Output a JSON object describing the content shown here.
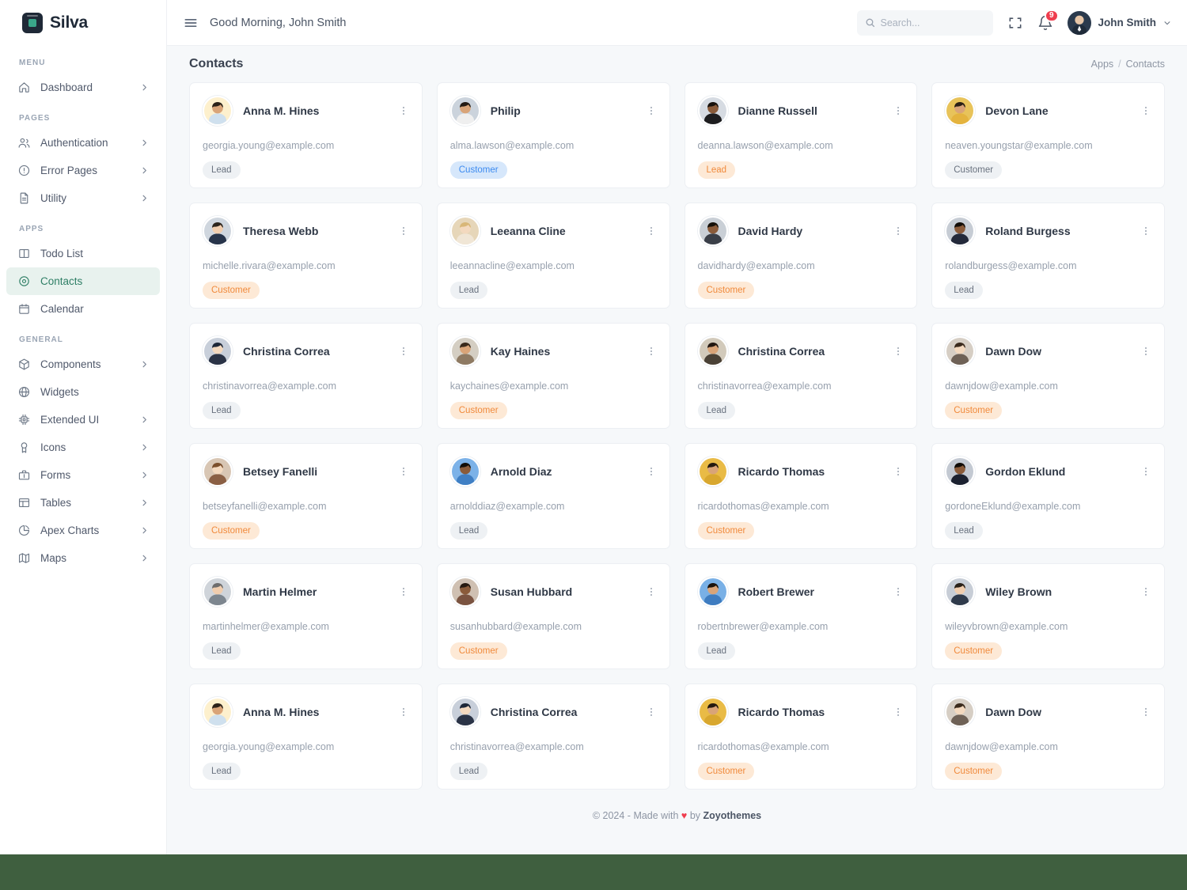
{
  "brand": {
    "name": "Silva",
    "logo_icon": "silva-logo-icon"
  },
  "sidebar": {
    "sections": [
      {
        "label": "MENU",
        "items": [
          {
            "label": "Dashboard",
            "icon": "home-icon",
            "chevron": true,
            "active": false
          }
        ]
      },
      {
        "label": "PAGES",
        "items": [
          {
            "label": "Authentication",
            "icon": "users-icon",
            "chevron": true,
            "active": false
          },
          {
            "label": "Error Pages",
            "icon": "alert-circle-icon",
            "chevron": true,
            "active": false
          },
          {
            "label": "Utility",
            "icon": "file-text-icon",
            "chevron": true,
            "active": false
          }
        ]
      },
      {
        "label": "APPS",
        "items": [
          {
            "label": "Todo List",
            "icon": "columns-icon",
            "chevron": false,
            "active": false
          },
          {
            "label": "Contacts",
            "icon": "map-pin-icon",
            "chevron": false,
            "active": true
          },
          {
            "label": "Calendar",
            "icon": "calendar-icon",
            "chevron": false,
            "active": false
          }
        ]
      },
      {
        "label": "GENERAL",
        "items": [
          {
            "label": "Components",
            "icon": "box-icon",
            "chevron": true,
            "active": false
          },
          {
            "label": "Widgets",
            "icon": "globe-icon",
            "chevron": false,
            "active": false
          },
          {
            "label": "Extended UI",
            "icon": "cpu-icon",
            "chevron": true,
            "active": false
          },
          {
            "label": "Icons",
            "icon": "award-icon",
            "chevron": true,
            "active": false
          },
          {
            "label": "Forms",
            "icon": "briefcase-icon",
            "chevron": true,
            "active": false
          },
          {
            "label": "Tables",
            "icon": "table-icon",
            "chevron": true,
            "active": false
          },
          {
            "label": "Apex Charts",
            "icon": "pie-chart-icon",
            "chevron": true,
            "active": false
          },
          {
            "label": "Maps",
            "icon": "map-icon",
            "chevron": true,
            "active": false
          }
        ]
      }
    ]
  },
  "topbar": {
    "menu_icon": "hamburger-icon",
    "greeting": "Good Morning, John Smith",
    "search": {
      "value": "",
      "placeholder": "Search...",
      "icon": "search-icon"
    },
    "fullscreen_icon": "fullscreen-icon",
    "notifications": {
      "icon": "bell-icon",
      "count": "9"
    },
    "user": {
      "name": "John Smith",
      "avatar": "user-avatar",
      "caret": "chevron-down-icon"
    }
  },
  "page": {
    "title": "Contacts",
    "breadcrumb": {
      "parent": "Apps",
      "separator": "/",
      "current": "Contacts"
    }
  },
  "colors": {
    "accent": "#2f7f66",
    "accent_bg": "#e8f2ee",
    "pill_gray_bg": "#eef1f4",
    "pill_gray_text": "#69727f",
    "pill_orange_bg": "#fde9d6",
    "pill_orange_text": "#f08a3c",
    "pill_blue_bg": "#d6e7fb",
    "pill_blue_text": "#3d8bf0",
    "badge_red": "#ef3d4e"
  },
  "contacts": [
    {
      "name": "Anna M. Hines",
      "email": "georgia.young@example.com",
      "tag": "Lead",
      "tag_style": "gray",
      "av": "m1",
      "ring": "#f7e3b6"
    },
    {
      "name": "Philip",
      "email": "alma.lawson@example.com",
      "tag": "Customer",
      "tag_style": "blue",
      "av": "m2",
      "ring": "#cfd6de"
    },
    {
      "name": "Dianne Russell",
      "email": "deanna.lawson@example.com",
      "tag": "Lead",
      "tag_style": "orange",
      "av": "m3",
      "ring": "#cfd6de"
    },
    {
      "name": "Devon Lane",
      "email": "neaven.youngstar@example.com",
      "tag": "Customer",
      "tag_style": "gray",
      "av": "m4",
      "ring": "#e8c35a"
    },
    {
      "name": "Theresa Webb",
      "email": "michelle.rivara@example.com",
      "tag": "Customer",
      "tag_style": "orange",
      "av": "m5",
      "ring": "#2f3a4b"
    },
    {
      "name": "Leeanna Cline",
      "email": "leeannacline@example.com",
      "tag": "Lead",
      "tag_style": "gray",
      "av": "f1",
      "ring": "#e8d7b6"
    },
    {
      "name": "David Hardy",
      "email": "davidhardy@example.com",
      "tag": "Customer",
      "tag_style": "orange",
      "av": "m6",
      "ring": "#3a3f48"
    },
    {
      "name": "Roland Burgess",
      "email": "rolandburgess@example.com",
      "tag": "Lead",
      "tag_style": "gray",
      "av": "m7",
      "ring": "#2b3240"
    },
    {
      "name": "Christina Correa",
      "email": "christinavorrea@example.com",
      "tag": "Lead",
      "tag_style": "gray",
      "av": "f2",
      "ring": "#27334a"
    },
    {
      "name": "Kay Haines",
      "email": "kaychaines@example.com",
      "tag": "Customer",
      "tag_style": "orange",
      "av": "m8",
      "ring": "#7d6a58"
    },
    {
      "name": "Christina Correa",
      "email": "christinavorrea@example.com",
      "tag": "Lead",
      "tag_style": "gray",
      "av": "f3",
      "ring": "#4a4136"
    },
    {
      "name": "Dawn Dow",
      "email": "dawnjdow@example.com",
      "tag": "Customer",
      "tag_style": "orange",
      "av": "f4",
      "ring": "#6e6156"
    },
    {
      "name": "Betsey Fanelli",
      "email": "betseyfanelli@example.com",
      "tag": "Customer",
      "tag_style": "orange",
      "av": "f5",
      "ring": "#8a5f44"
    },
    {
      "name": "Arnold Diaz",
      "email": "arnolddiaz@example.com",
      "tag": "Lead",
      "tag_style": "gray",
      "av": "m9",
      "ring": "#4f8ed6"
    },
    {
      "name": "Ricardo Thomas",
      "email": "ricardothomas@example.com",
      "tag": "Customer",
      "tag_style": "orange",
      "av": "m10",
      "ring": "#e0b23c"
    },
    {
      "name": "Gordon Eklund",
      "email": "gordoneEklund@example.com",
      "tag": "Lead",
      "tag_style": "gray",
      "av": "m11",
      "ring": "#252b38"
    },
    {
      "name": "Martin Helmer",
      "email": "martinhelmer@example.com",
      "tag": "Lead",
      "tag_style": "gray",
      "av": "m12",
      "ring": "#5b6470"
    },
    {
      "name": "Susan Hubbard",
      "email": "susanhubbard@example.com",
      "tag": "Customer",
      "tag_style": "orange",
      "av": "f6",
      "ring": "#7a5340"
    },
    {
      "name": "Robert Brewer",
      "email": "robertnbrewer@example.com",
      "tag": "Lead",
      "tag_style": "gray",
      "av": "m13",
      "ring": "#4f8ed6"
    },
    {
      "name": "Wiley Brown",
      "email": "wileyvbrown@example.com",
      "tag": "Customer",
      "tag_style": "orange",
      "av": "m14",
      "ring": "#3a4455"
    },
    {
      "name": "Anna M. Hines",
      "email": "georgia.young@example.com",
      "tag": "Lead",
      "tag_style": "gray",
      "av": "m1",
      "ring": "#f7e3b6"
    },
    {
      "name": "Christina Correa",
      "email": "christinavorrea@example.com",
      "tag": "Lead",
      "tag_style": "gray",
      "av": "f2",
      "ring": "#27334a"
    },
    {
      "name": "Ricardo Thomas",
      "email": "ricardothomas@example.com",
      "tag": "Customer",
      "tag_style": "orange",
      "av": "m10",
      "ring": "#e0b23c"
    },
    {
      "name": "Dawn Dow",
      "email": "dawnjdow@example.com",
      "tag": "Customer",
      "tag_style": "orange",
      "av": "f4",
      "ring": "#6e6156"
    }
  ],
  "footer": {
    "copyright": "© 2024 - Made with",
    "heart": "♥",
    "by": "by",
    "brand": "Zoyothemes"
  }
}
